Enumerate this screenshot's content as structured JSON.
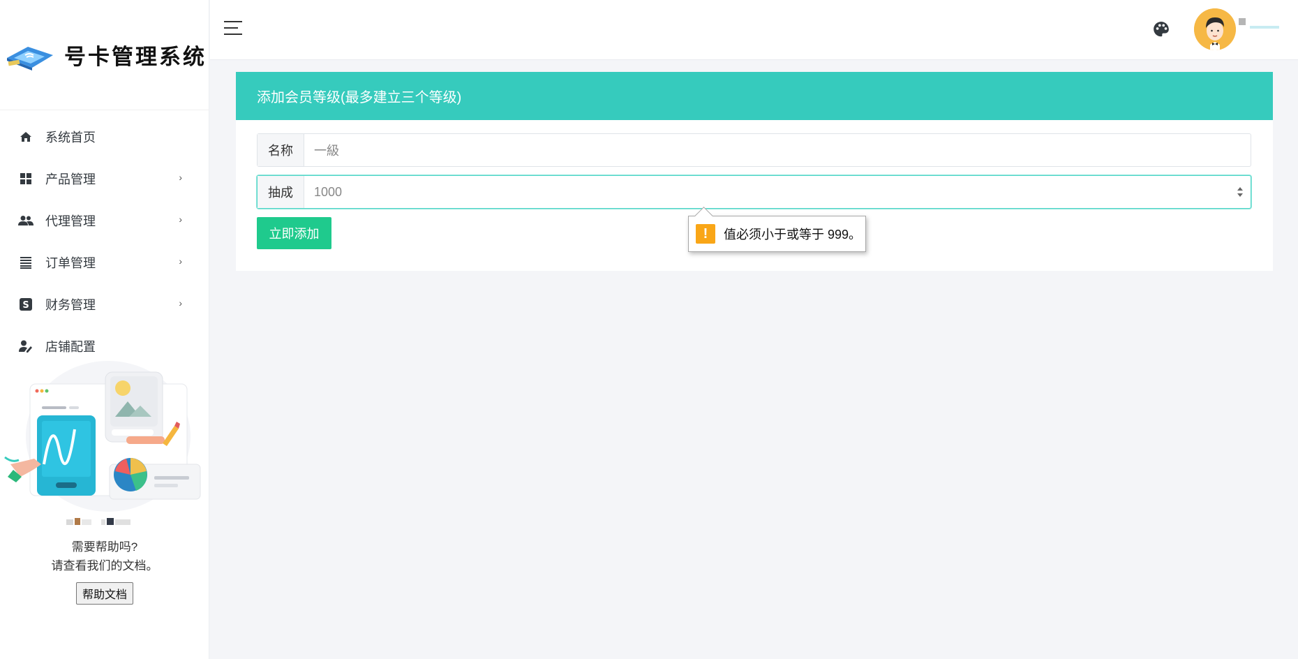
{
  "brand": {
    "name": "号卡管理系统",
    "logo_icon": "sim-card-logo-icon"
  },
  "sidebar": {
    "items": [
      {
        "label": "系统首页",
        "icon": "home-icon",
        "has_submenu": false
      },
      {
        "label": "产品管理",
        "icon": "grid-icon",
        "has_submenu": true
      },
      {
        "label": "代理管理",
        "icon": "users-icon",
        "has_submenu": true
      },
      {
        "label": "订单管理",
        "icon": "list-icon",
        "has_submenu": true
      },
      {
        "label": "财务管理",
        "icon": "dollar-icon",
        "has_submenu": true
      },
      {
        "label": "店铺配置",
        "icon": "user-edit-icon",
        "has_submenu": false
      }
    ],
    "submenu_arrow": "›",
    "help": {
      "line1": "需要帮助吗?",
      "line2": "请查看我们的文档。",
      "button": "帮助文档"
    }
  },
  "header": {
    "menu_toggle_icon": "hamburger-icon",
    "theme_icon": "palette-icon",
    "avatar_icon": "avatar-icon"
  },
  "form": {
    "title": "添加会员等级(最多建立三个等级)",
    "name_label": "名称",
    "name_value": "一級",
    "commission_label": "抽成",
    "commission_value": "1000",
    "submit_label": "立即添加"
  },
  "validation": {
    "icon": "warning-icon",
    "icon_glyph": "!",
    "message": "值必须小于或等于 999。"
  },
  "colors": {
    "accent": "#36cbbd",
    "submit": "#1fca8d",
    "warning": "#f9a617"
  }
}
